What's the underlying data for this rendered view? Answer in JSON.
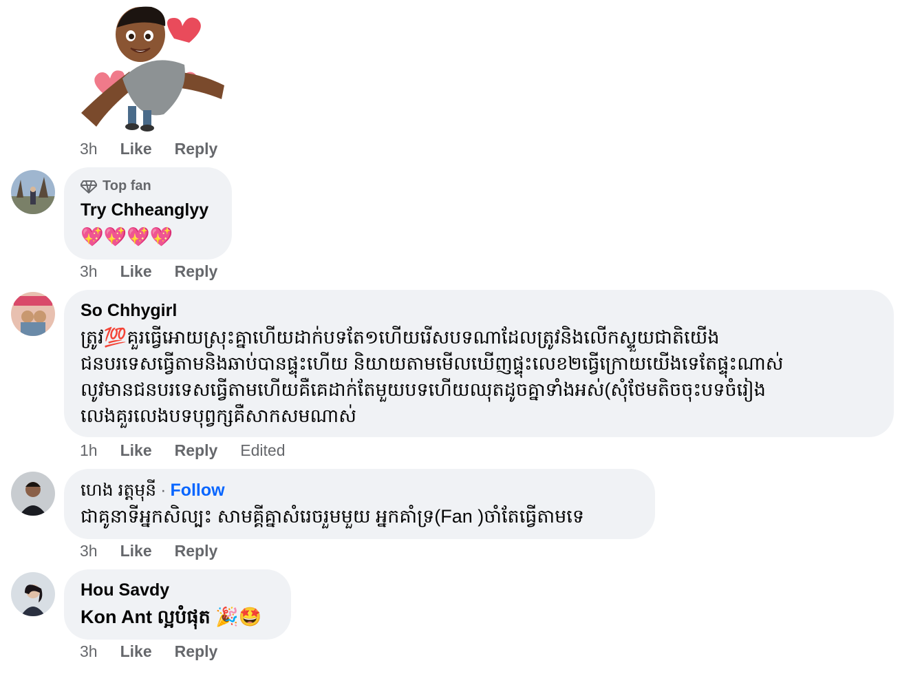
{
  "comments": [
    {
      "time": "3h",
      "like": "Like",
      "reply": "Reply"
    },
    {
      "badge": "Top fan",
      "name": "Try Chheanglyy",
      "text": "💖💖💖💖",
      "time": "3h",
      "like": "Like",
      "reply": "Reply"
    },
    {
      "name": "So Chhygirl",
      "lines": [
        "ត្រូវ💯គួរធ្វើអោយស្រុះគ្នាហើយដាក់បទតែ១ហើយរើសបទណាដែលត្រូវនិងលើកស្ទួយជាតិយើង",
        "ជនបរទេសធ្វើតាមនិងឆាប់បានផ្ទុះហើយ និយាយតាមមើលឃើញផ្ទុះលេខ២ធ្វើក្រោយយើងទេតែផ្ទុះណាស់",
        "លូវមានជនបរទេសធ្វើតាមហើយគឺគេដាក់តែមួយបទហើយឈុតដូចគ្នាទាំងអស់(សុំថែមតិចចុះបទចំរៀង",
        "លេងគួរលេងបទបុព្វក្សគឺសាកសមណាស់"
      ],
      "time": "1h",
      "like": "Like",
      "reply": "Reply",
      "edited": "Edited"
    },
    {
      "name": "ហេង រត្តមុនី",
      "follow": "Follow",
      "text": "ជាគូនាទីអ្នកសិល្បះ សាមគ្គីគ្នាសំរេចរួមមួយ អ្នកគាំទ្រ(Fan )ចាំតែធ្វើតាមទេ",
      "time": "3h",
      "like": "Like",
      "reply": "Reply"
    },
    {
      "name": "Hou Savdy",
      "text": "Kon Ant ល្អបំផុត 🎉🤩",
      "time": "3h",
      "like": "Like",
      "reply": "Reply"
    }
  ],
  "colors": {
    "bubble": "#f0f2f5",
    "meta": "#65676b",
    "link": "#0866ff"
  }
}
